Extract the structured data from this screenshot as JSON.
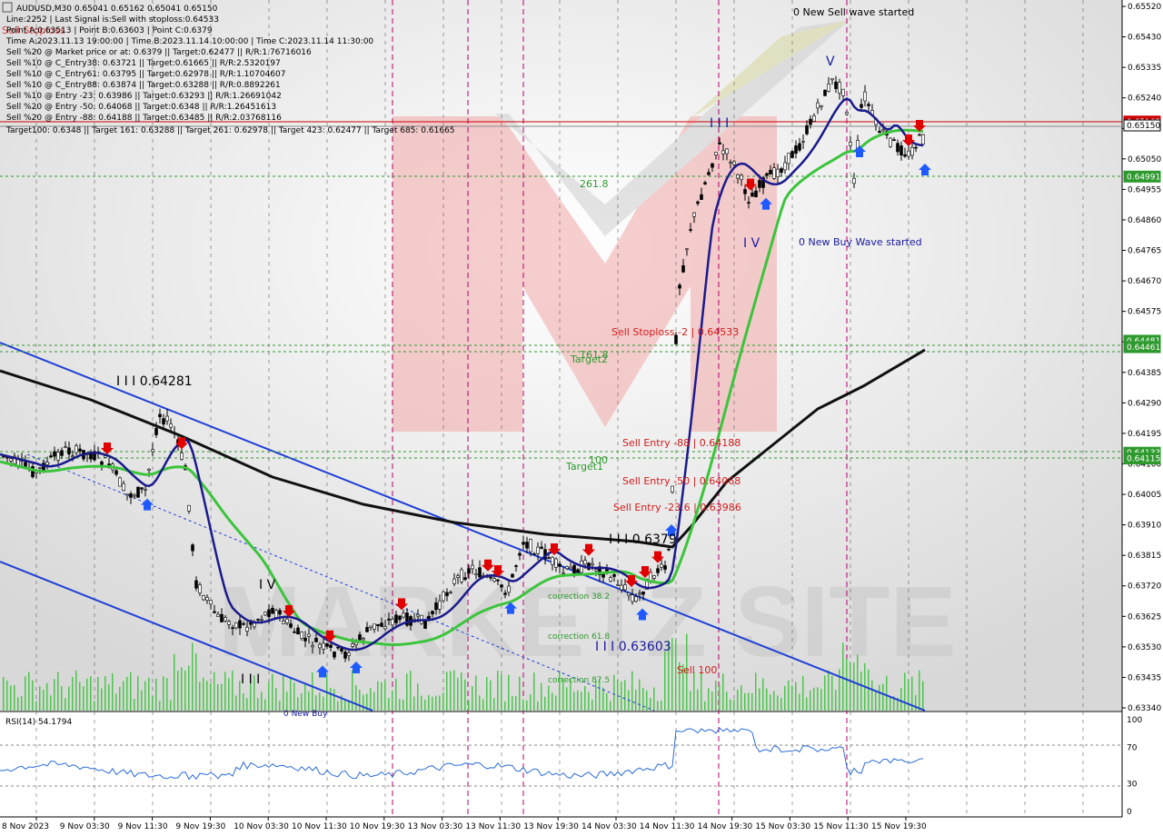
{
  "colors": {
    "ma_fast": "#1a1a8c",
    "ma_mid": "#3cc43c",
    "ma_slow": "#111111",
    "channel": "#1f3fd6",
    "sell_line": "#cc0000",
    "buy_arrow": "#1e5aff",
    "sell_arrow": "#e00000",
    "target_green": "#2e9a2e",
    "vline": "#b4006e",
    "price_box_red": "#cc0000",
    "price_box_green": "#2e9a2e",
    "volume": "#4cc64c",
    "rsi_line": "#2a6bd6"
  },
  "header": {
    "symbol_line": "AUDUSD,M30  0.65041 0.65162 0.65041 0.65150",
    "info_lines": [
      "Line:2252 | Last Signal is:Sell with stoploss:0.64533",
      "Point A:0.63513 | Point B:0.63603 | Point C:0.6379",
      "Time A:2023.11.13 19:00:00 | Time B:2023.11.14 10:00:00 | Time C:2023.11.14 11:30:00",
      "Sell %20 @ Market price or at: 0.6379 || Target:0.62477 || R/R:1.76716016",
      "Sell %10 @ C_Entry38: 0.63721 || Target:0.61665 || R/R:2.5320197",
      "Sell %10 @ C_Entry61: 0.63795 || Target:0.62978 || R/R:1.10704607",
      "Sell %10 @ C_Entry88: 0.63874 || Target:0.63288 || R/R:0.8892261",
      "Sell %10 @ Entry -23: 0.63986 || Target:0.63293 || R/R:1.26691042",
      "Sell %20 @ Entry -50: 0.64068 || Target:0.6348 || R/R:1.26451613",
      "Sell %20 @ Entry -88: 0.64188 || Target:0.63485 || R/R:2.03768116"
    ],
    "targets_line": "Target100: 0.6348 || Target 161: 0.63288 || Target 261: 0.62978 || Target 423: 0.62477 || Target 685: 0.61665",
    "overlap_text": "Sell Stoploss"
  },
  "annotations": {
    "new_sell_wave": "0 New Sell wave started",
    "new_buy_wave": "0 New Buy Wave started",
    "sell_stoploss": "Sell Stoploss -2 | 0.64533",
    "sell_entry_88": "Sell Entry -88 | 0.64188",
    "sell_entry_50": "Sell Entry -50 | 0.64068",
    "sell_entry_23": "Sell Entry -23.6 | 0.63986",
    "sell_100": "Sell 100",
    "target2": "Target2",
    "target1": "Target1",
    "fib_261": "261.8",
    "fib_161": "161.8",
    "fib_100": "100",
    "correction_382": "correction 38.2",
    "correction_618": "correction 61.8",
    "correction_875": "correction 87.5",
    "wave_label_A": "I I I 0.64281",
    "wave_label_C": "I I I 0.6379",
    "wave_label_B": "I I I 0.63603",
    "wave_iv_left": "I V",
    "wave_iii_left": "I I I",
    "wave_iv_right": "I V",
    "wave_v_right": "V",
    "wave_iii_right": "I I I",
    "bottom_partial": "0 New Buy"
  },
  "price_axis": {
    "ticks": [
      "0.65520",
      "0.65430",
      "0.65335",
      "0.65240",
      "0.65150",
      "0.65050",
      "0.64955",
      "0.64860",
      "0.64765",
      "0.64670",
      "0.64575",
      "0.64480",
      "0.64385",
      "0.64290",
      "0.64195",
      "0.64100",
      "0.64005",
      "0.63910",
      "0.63815",
      "0.63720",
      "0.63625",
      "0.63530",
      "0.63435",
      "0.63340"
    ],
    "current_price": "0.65150",
    "boxes": [
      {
        "label": "0.65162",
        "kind": "red"
      },
      {
        "label": "0.65150",
        "kind": "white"
      },
      {
        "label": "0.64991",
        "kind": "green"
      },
      {
        "label": "0.64481",
        "kind": "green"
      },
      {
        "label": "0.64461",
        "kind": "green"
      },
      {
        "label": "0.64133",
        "kind": "green"
      },
      {
        "label": "0.64115",
        "kind": "green"
      }
    ]
  },
  "time_axis": {
    "labels": [
      "8 Nov 2023",
      "9 Nov 03:30",
      "9 Nov 11:30",
      "9 Nov 19:30",
      "10 Nov 03:30",
      "10 Nov 11:30",
      "10 Nov 19:30",
      "13 Nov 03:30",
      "13 Nov 11:30",
      "13 Nov 19:30",
      "14 Nov 03:30",
      "14 Nov 11:30",
      "14 Nov 19:30",
      "15 Nov 03:30",
      "15 Nov 11:30",
      "15 Nov 19:30"
    ]
  },
  "rsi": {
    "title": "RSI(14) 54.1794",
    "ticks": [
      "100",
      "70",
      "30",
      "0"
    ]
  },
  "watermark": {
    "text": "MARKETZ SITE"
  },
  "chart_data": {
    "type": "line",
    "title": "AUDUSD,M30",
    "symbol": "AUDUSD",
    "timeframe": "M30",
    "ohlc_current": {
      "open": 0.65041,
      "high": 0.65162,
      "low": 0.65041,
      "close": 0.6515
    },
    "ylim": [
      0.6334,
      0.6552
    ],
    "price_series_approx": [
      {
        "t": "8 Nov 2023",
        "close": 0.641
      },
      {
        "t": "9 Nov 03:30",
        "close": 0.6408
      },
      {
        "t": "9 Nov 11:30",
        "close": 0.641
      },
      {
        "t": "9 Nov 19:30",
        "close": 0.6412
      },
      {
        "t": "10 Nov 03:30",
        "close": 0.6366
      },
      {
        "t": "10 Nov 11:30",
        "close": 0.6358
      },
      {
        "t": "10 Nov 19:30",
        "close": 0.636
      },
      {
        "t": "13 Nov 03:30",
        "close": 0.6365
      },
      {
        "t": "13 Nov 11:30",
        "close": 0.6375
      },
      {
        "t": "13 Nov 19:30",
        "close": 0.638
      },
      {
        "t": "14 Nov 03:30",
        "close": 0.637
      },
      {
        "t": "14 Nov 11:30",
        "close": 0.6379
      },
      {
        "t": "14 Nov 19:30",
        "close": 0.65
      },
      {
        "t": "15 Nov 03:30",
        "close": 0.6496
      },
      {
        "t": "15 Nov 11:30",
        "close": 0.6512
      },
      {
        "t": "15 Nov 19:30",
        "close": 0.6515
      }
    ],
    "levels": [
      {
        "name": "Sell Stoploss -2",
        "value": 0.64533
      },
      {
        "name": "Sell Entry -88",
        "value": 0.64188
      },
      {
        "name": "Sell Entry -50",
        "value": 0.64068
      },
      {
        "name": "Sell Entry -23.6",
        "value": 0.63986
      },
      {
        "name": "Target1",
        "value": 0.6412
      },
      {
        "name": "Target2",
        "value": 0.6446
      }
    ],
    "rsi_value": 54.1794,
    "rsi_ylim": [
      0,
      100
    ],
    "rsi_levels": [
      30,
      70
    ]
  }
}
